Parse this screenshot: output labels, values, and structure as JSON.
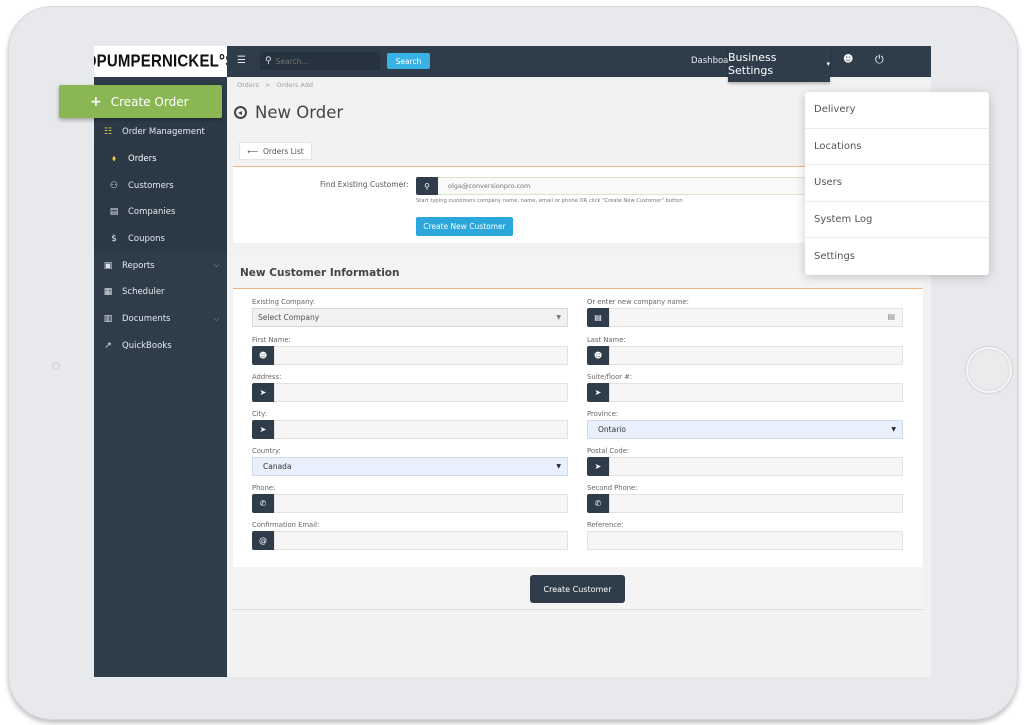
{
  "brand": {
    "logo_text": "ƆPUMPERNICKEL°S"
  },
  "topbar": {
    "menu_icon": "☰",
    "search_icon": "⚲",
    "search_placeholder": "Search...",
    "search_button": "Search",
    "dashboard_link": "Dashboard",
    "business_settings": "Business Settings",
    "caret": "▾",
    "user_icon": "☻",
    "power_icon": "⏻"
  },
  "sidebar": {
    "create_order": {
      "icon": "+",
      "label": "Create Order"
    },
    "items": [
      {
        "label": "Order Management",
        "icon": "☷",
        "level": 0
      },
      {
        "label": "Orders",
        "icon": "⬧",
        "level": 1,
        "active": true
      },
      {
        "label": "Customers",
        "icon": "⚇",
        "level": 1
      },
      {
        "label": "Companies",
        "icon": "▤",
        "level": 1
      },
      {
        "label": "Coupons",
        "icon": "$",
        "level": 1
      },
      {
        "label": "Reports",
        "icon": "▣",
        "level": 0,
        "has_children": true
      },
      {
        "label": "Scheduler",
        "icon": "▦",
        "level": 0
      },
      {
        "label": "Documents",
        "icon": "▥",
        "level": 0,
        "has_children": true
      },
      {
        "label": "QuickBooks",
        "icon": "↗",
        "level": 0
      }
    ],
    "chevron": "⌵"
  },
  "breadcrumb": [
    "Orders",
    ">",
    "Orders Add"
  ],
  "page": {
    "title": "New Order"
  },
  "orders_list_button": {
    "icon": "⟵",
    "label": "Orders List"
  },
  "find_customer": {
    "label": "Find Existing Customer:",
    "icon": "⚲",
    "placeholder": "olga@conversionpro.com",
    "help": "Start typing customers company name, name, email or phone OR click \"Create New Customer\" button",
    "create_button": "Create New Customer"
  },
  "new_customer": {
    "header": "New Customer Information",
    "fields": {
      "existing_company": {
        "label": "Existing Company:",
        "value": "Select Company"
      },
      "new_company": {
        "label": "Or enter new company name:",
        "icon": "▤",
        "value": ""
      },
      "first_name": {
        "label": "First Name:",
        "icon": "☻",
        "value": ""
      },
      "last_name": {
        "label": "Last Name:",
        "icon": "☻",
        "value": ""
      },
      "address": {
        "label": "Address:",
        "icon": "➤",
        "value": ""
      },
      "suite": {
        "label": "Suite/floor #:",
        "icon": "➤",
        "value": ""
      },
      "city": {
        "label": "City:",
        "icon": "➤",
        "value": ""
      },
      "province": {
        "label": "Province:",
        "value": "Ontario"
      },
      "country": {
        "label": "Country:",
        "value": "Canada"
      },
      "postal_code": {
        "label": "Postal Code:",
        "icon": "➤",
        "value": ""
      },
      "phone": {
        "label": "Phone:",
        "icon": "✆",
        "value": ""
      },
      "second_phone": {
        "label": "Second Phone:",
        "icon": "✆",
        "value": ""
      },
      "confirmation_email": {
        "label": "Confirmation Email:",
        "icon": "@",
        "value": ""
      },
      "reference": {
        "label": "Reference:",
        "value": ""
      }
    },
    "submit_button": "Create Customer"
  },
  "business_settings_menu": [
    "Delivery",
    "Locations",
    "Users",
    "System Log",
    "Settings"
  ],
  "colors": {
    "sidebar_bg": "#2f3d4b",
    "accent_green": "#8ab653",
    "accent_blue": "#2ba7dc",
    "accent_orange": "#f0b383",
    "active_yellow": "#f0c93a"
  }
}
